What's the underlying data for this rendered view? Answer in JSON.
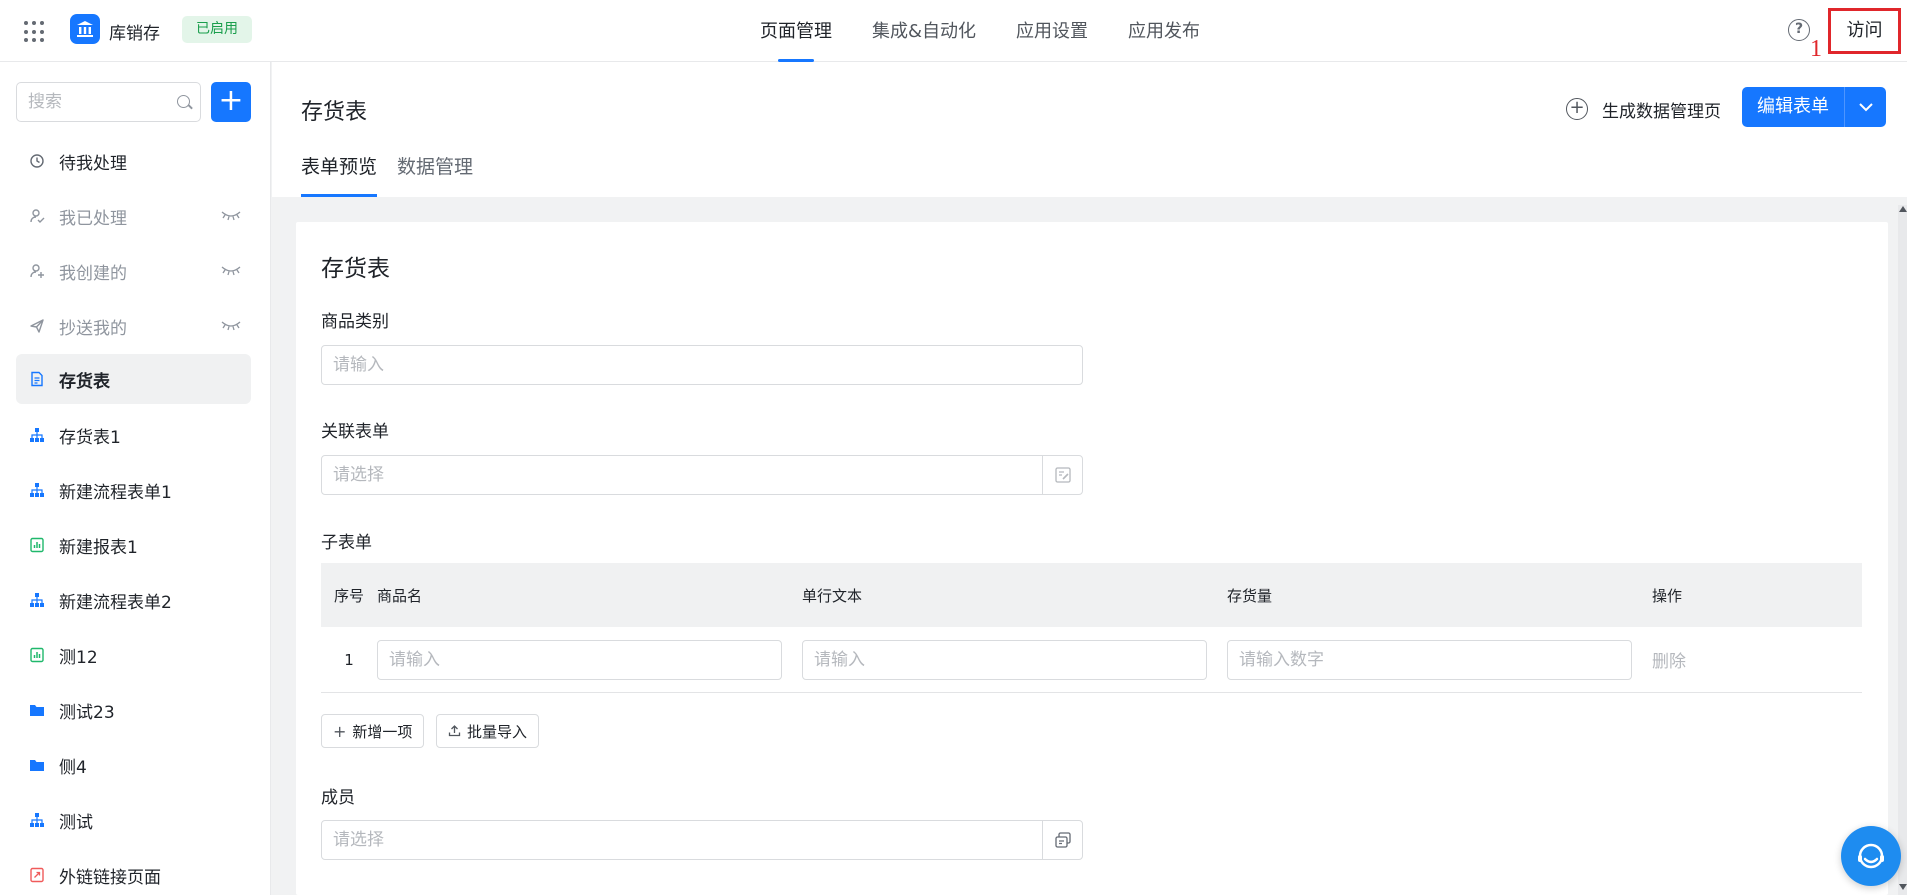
{
  "header": {
    "app_name": "库销存",
    "app_status": "已启用",
    "nav": [
      {
        "label": "页面管理",
        "active": true
      },
      {
        "label": "集成&自动化",
        "active": false
      },
      {
        "label": "应用设置",
        "active": false
      },
      {
        "label": "应用发布",
        "active": false
      }
    ],
    "help_label": "?",
    "annotation_number": "1",
    "visit_label": "访问"
  },
  "sidebar": {
    "search_placeholder": "搜索",
    "add_label": "+",
    "items": [
      {
        "label": "待我处理",
        "icon": "clock-icon"
      },
      {
        "label": "我已处理",
        "icon": "user-check-icon",
        "hidden": true
      },
      {
        "label": "我创建的",
        "icon": "user-add-icon",
        "hidden": true
      },
      {
        "label": "抄送我的",
        "icon": "send-icon",
        "hidden": true
      },
      {
        "label": "存货表",
        "icon": "document-icon",
        "active": true
      },
      {
        "label": "存货表1",
        "icon": "flow-icon"
      },
      {
        "label": "新建流程表单1",
        "icon": "flow-icon"
      },
      {
        "label": "新建报表1",
        "icon": "report-icon"
      },
      {
        "label": "新建流程表单2",
        "icon": "flow-icon"
      },
      {
        "label": "测12",
        "icon": "report-icon"
      },
      {
        "label": "测试23",
        "icon": "folder-icon"
      },
      {
        "label": "侧4",
        "icon": "folder-icon"
      },
      {
        "label": "测试",
        "icon": "flow-icon"
      },
      {
        "label": "外链链接页面",
        "icon": "link-page-icon"
      }
    ]
  },
  "main": {
    "title": "存货表",
    "generate_label": "生成数据管理页",
    "edit_label": "编辑表单",
    "tabs": [
      {
        "label": "表单预览",
        "active": true
      },
      {
        "label": "数据管理",
        "active": false
      }
    ]
  },
  "form": {
    "title": "存货表",
    "fields": {
      "category": {
        "label": "商品类别",
        "placeholder": "请输入"
      },
      "related": {
        "label": "关联表单",
        "placeholder": "请选择"
      },
      "subform": {
        "label": "子表单"
      },
      "member": {
        "label": "成员",
        "placeholder": "请选择"
      }
    },
    "subtable": {
      "headers": {
        "index": "序号",
        "name": "商品名",
        "text": "单行文本",
        "stock": "存货量",
        "op": "操作"
      },
      "rows": [
        {
          "index": "1",
          "name_ph": "请输入",
          "text_ph": "请输入",
          "stock_ph": "请输入数字",
          "op": "删除"
        }
      ],
      "add_label": "新增一项",
      "import_label": "批量导入"
    }
  },
  "colors": {
    "accent": "#1677ff",
    "badge_bg": "#e3f5e9",
    "badge_text": "#1a9e4c",
    "annotation": "#e0262b"
  }
}
